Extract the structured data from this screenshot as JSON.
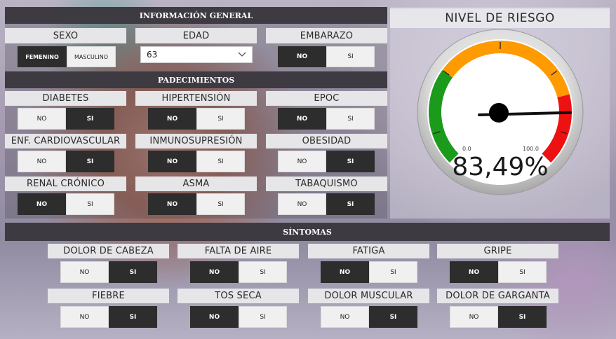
{
  "sections": {
    "general": "INFORMACIÓN GENERAL",
    "conditions": "PADECIMIENTOS",
    "symptoms": "SÍNTOMAS"
  },
  "sexo": {
    "label": "SEXO",
    "options": [
      "FEMENINO",
      "MASCULINO"
    ],
    "selected": "FEMENINO"
  },
  "edad": {
    "label": "EDAD",
    "value": "63"
  },
  "embarazo": {
    "label": "EMBARAZO",
    "options": [
      "NO",
      "SI"
    ],
    "selected": "NO"
  },
  "conditions": [
    {
      "id": "diabetes",
      "label": "DIABETES",
      "options": [
        "NO",
        "SI"
      ],
      "selected": "SI"
    },
    {
      "id": "hipertension",
      "label": "HIPERTENSIÓN",
      "options": [
        "NO",
        "SI"
      ],
      "selected": "NO"
    },
    {
      "id": "epoc",
      "label": "EPOC",
      "options": [
        "NO",
        "SI"
      ],
      "selected": "NO"
    },
    {
      "id": "cardiovascular",
      "label": "ENF. CARDIOVASCULAR",
      "options": [
        "NO",
        "SI"
      ],
      "selected": "SI"
    },
    {
      "id": "inmunosupresion",
      "label": "INMUNOSUPRESIÓN",
      "options": [
        "NO",
        "SI"
      ],
      "selected": "NO"
    },
    {
      "id": "obesidad",
      "label": "OBESIDAD",
      "options": [
        "NO",
        "SI"
      ],
      "selected": "SI"
    },
    {
      "id": "renal",
      "label": "RENAL CRÓNICO",
      "options": [
        "NO",
        "SI"
      ],
      "selected": "NO"
    },
    {
      "id": "asma",
      "label": "ASMA",
      "options": [
        "NO",
        "SI"
      ],
      "selected": "NO"
    },
    {
      "id": "tabaquismo",
      "label": "TABAQUISMO",
      "options": [
        "NO",
        "SI"
      ],
      "selected": "SI"
    }
  ],
  "symptoms": [
    {
      "id": "dolor-cabeza",
      "label": "DOLOR DE CABEZA",
      "options": [
        "NO",
        "SI"
      ],
      "selected": "SI"
    },
    {
      "id": "falta-aire",
      "label": "FALTA DE AIRE",
      "options": [
        "NO",
        "SI"
      ],
      "selected": "NO"
    },
    {
      "id": "fatiga",
      "label": "FATIGA",
      "options": [
        "NO",
        "SI"
      ],
      "selected": "NO"
    },
    {
      "id": "gripe",
      "label": "GRIPE",
      "options": [
        "NO",
        "SI"
      ],
      "selected": "NO"
    },
    {
      "id": "fiebre",
      "label": "FIEBRE",
      "options": [
        "NO",
        "SI"
      ],
      "selected": "SI"
    },
    {
      "id": "tos-seca",
      "label": "TOS SECA",
      "options": [
        "NO",
        "SI"
      ],
      "selected": "NO"
    },
    {
      "id": "dolor-muscular",
      "label": "DOLOR MUSCULAR",
      "options": [
        "NO",
        "SI"
      ],
      "selected": "SI"
    },
    {
      "id": "dolor-garganta",
      "label": "DOLOR DE GARGANTA",
      "options": [
        "NO",
        "SI"
      ],
      "selected": "SI"
    }
  ],
  "gauge": {
    "title": "NIVEL DE RIESGO",
    "min": 0,
    "max": 100,
    "min_label": "0.0",
    "max_label": "100.0",
    "value": 83.49,
    "value_label": "83,49%",
    "bands": [
      {
        "from": 0,
        "to": 30,
        "color": "#1c9a1c"
      },
      {
        "from": 30,
        "to": 78,
        "color": "#ff9a00"
      },
      {
        "from": 78,
        "to": 100,
        "color": "#ee1111"
      }
    ]
  }
}
